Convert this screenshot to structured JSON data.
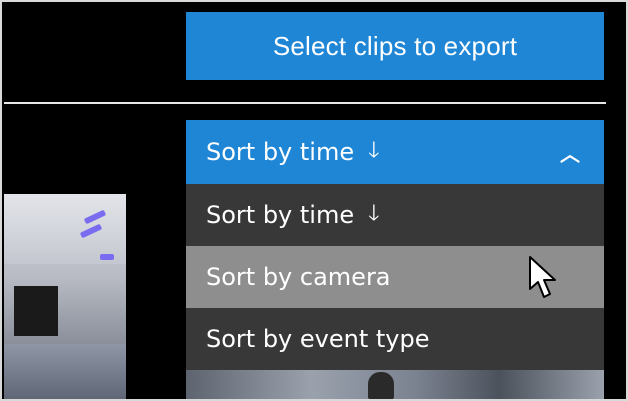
{
  "toolbar": {
    "export_label": "Select clips to export"
  },
  "sort_dropdown": {
    "selected_label": "Sort by time",
    "selected_icon": "arrow-down-icon",
    "toggle_icon": "chevron-up-icon",
    "options": [
      {
        "label": "Sort by time",
        "icon": "arrow-down-icon"
      },
      {
        "label": "Sort by camera"
      },
      {
        "label": "Sort by event type"
      }
    ],
    "hovered_option": "Sort by camera"
  },
  "colors": {
    "accent": "#1f86d6",
    "menu_bg": "#3c3c3c",
    "menu_hover": "#969696"
  }
}
